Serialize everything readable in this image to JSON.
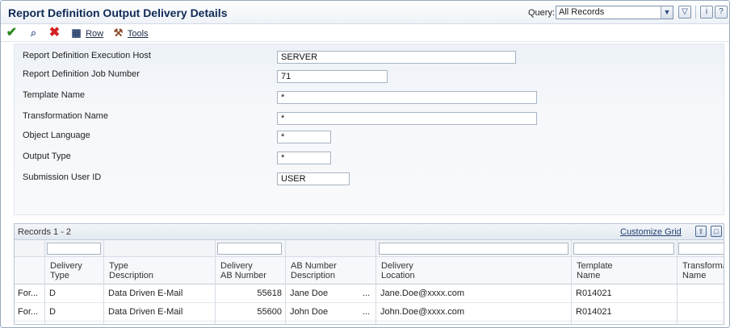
{
  "window": {
    "title": "Report Definition Output Delivery Details",
    "query_label": "Query:",
    "query_value": "All Records"
  },
  "toolbar": {
    "row_label": "Row",
    "tools_label": "Tools"
  },
  "form": {
    "fields": [
      {
        "label": "Report Definition Execution Host",
        "value": "SERVER"
      },
      {
        "label": "Report Definition Job Number",
        "value": "71"
      },
      {
        "label": "Template Name",
        "value": "*"
      },
      {
        "label": "Transformation Name",
        "value": "*"
      },
      {
        "label": "Object Language",
        "value": "*"
      },
      {
        "label": "Output Type",
        "value": "*"
      },
      {
        "label": "Submission User ID",
        "value": "USER"
      }
    ]
  },
  "grid": {
    "records_label": "Records 1 - 2",
    "customize_label": "Customize Grid",
    "columns": [
      "",
      "Delivery\nType",
      "Type\nDescription",
      "Delivery\nAB Number",
      "AB Number\nDescription",
      "Delivery\nLocation",
      "Template\nName",
      "Transforma\nName"
    ],
    "rows": [
      [
        "For...",
        "D",
        "Data Driven E-Mail",
        "55618",
        "Jane Doe",
        "...",
        "Jane.Doe@xxxx.com",
        "R014021",
        ""
      ],
      [
        "For...",
        "D",
        "Data Driven E-Mail",
        "55600",
        "John Doe",
        "...",
        "John.Doe@xxxx.com",
        "R014021",
        ""
      ]
    ]
  },
  "icons": {
    "ok": "checkmark-icon",
    "find": "magnifier-icon",
    "cancel": "x-icon",
    "row": "grid-icon",
    "tools": "tools-icon"
  },
  "colors": {
    "title": "#0f2a55",
    "ok_green": "#2e8b1f",
    "cancel_red": "#d32020"
  }
}
